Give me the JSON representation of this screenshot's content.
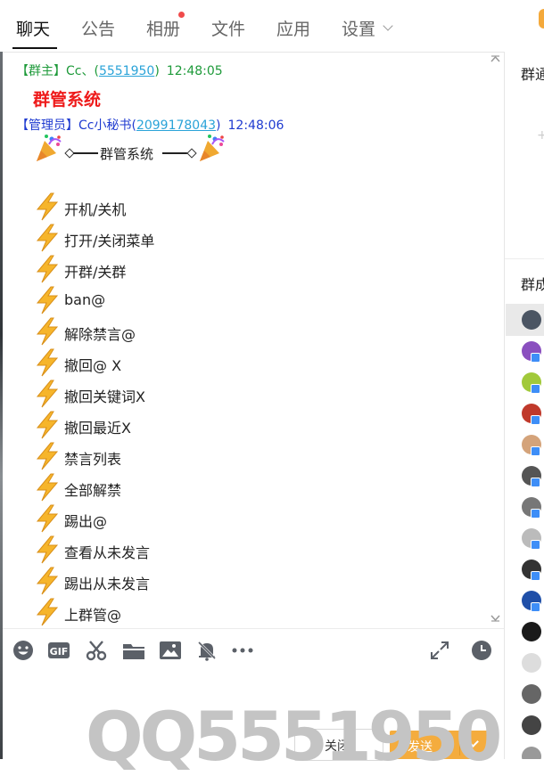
{
  "tabs": [
    {
      "label": "聊天",
      "active": true
    },
    {
      "label": "公告"
    },
    {
      "label": "相册",
      "has_dot": true
    },
    {
      "label": "文件"
    },
    {
      "label": "应用"
    },
    {
      "label": "设置"
    }
  ],
  "messages": [
    {
      "role": "【群主】",
      "name": "Cc、",
      "qq": "5551950",
      "time": "12:48:05",
      "text": "群管系统"
    },
    {
      "role": "【管理员】",
      "name": "Cc小秘书",
      "qq": "2099178043",
      "time": "12:48:06",
      "banner": "群管系统"
    }
  ],
  "commands": [
    "开机/关机",
    "打开/关闭菜单",
    "开群/关群",
    "ban@",
    "解除禁言@",
    "撤回@ X",
    "撤回关键词X",
    "撤回最近X",
    "禁言列表",
    "全部解禁",
    "踢出@",
    "查看从未发言",
    "踢出从未发言",
    "上群管@"
  ],
  "toolbar_icons": [
    "emoji-icon",
    "gif-icon",
    "scissors-icon",
    "folder-icon",
    "image-icon",
    "bell-off-icon",
    "more-icon",
    "expand-icon",
    "clock-icon"
  ],
  "watermark": "QQ5551950",
  "buttons": {
    "close": "关闭",
    "send": "发送"
  },
  "right_panel": {
    "announce_title": "群通知",
    "members_title": "群成员"
  },
  "colors": {
    "send": "#f4ac3e",
    "owner": "#1e9a3a",
    "admin": "#1e3ad0",
    "title_red": "#ee1a1a",
    "link": "#2aa3d8"
  }
}
